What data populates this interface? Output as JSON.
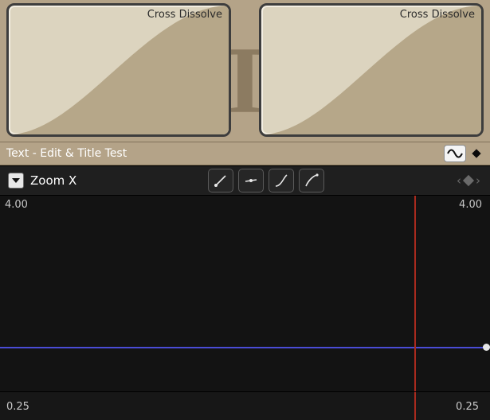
{
  "transitions": {
    "left": {
      "label": "Cross Dissolve"
    },
    "right": {
      "label": "Cross Dissolve"
    }
  },
  "header": {
    "title": "Text - Edit & Title Test"
  },
  "param": {
    "name": "Zoom X",
    "value_top_left": "4.00",
    "value_top_right": "4.00"
  },
  "ruler": {
    "start": "0.25",
    "end": "0.25"
  },
  "colors": {
    "strip_bg": "#b4a388",
    "curve_line": "#4a4cd6",
    "playhead": "#a82a1e"
  }
}
